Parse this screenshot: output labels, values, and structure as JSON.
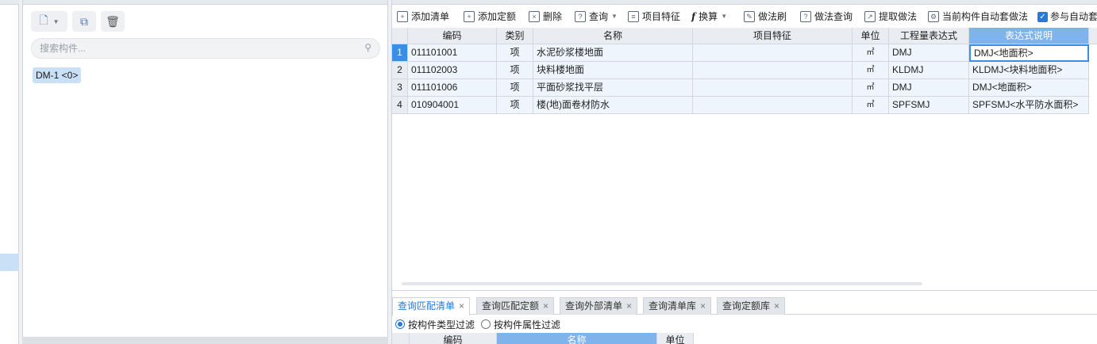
{
  "search": {
    "placeholder": "搜索构件..."
  },
  "component": {
    "item_label": "DM-1 <0>"
  },
  "toolbar": {
    "add_list": "添加清单",
    "add_quota": "添加定额",
    "delete": "删除",
    "query": "查询",
    "item_feature": "项目特征",
    "convert": "换算",
    "method_brush": "做法刷",
    "method_query": "做法查询",
    "extract_method": "提取做法",
    "auto_apply": "当前构件自动套做法",
    "participate_auto": "参与自动套"
  },
  "grid": {
    "columns": [
      "编码",
      "类别",
      "名称",
      "项目特征",
      "单位",
      "工程量表达式",
      "表达式说明"
    ],
    "rows": [
      {
        "index": "1",
        "code": "011101001",
        "type": "项",
        "name": "水泥砂浆楼地面",
        "feature": "",
        "unit": "㎡",
        "expr": "DMJ",
        "desc": "DMJ<地面积>"
      },
      {
        "index": "2",
        "code": "011102003",
        "type": "项",
        "name": "块料楼地面",
        "feature": "",
        "unit": "㎡",
        "expr": "KLDMJ",
        "desc": "KLDMJ<块料地面积>"
      },
      {
        "index": "3",
        "code": "011101006",
        "type": "项",
        "name": "平面砂浆找平层",
        "feature": "",
        "unit": "㎡",
        "expr": "DMJ",
        "desc": "DMJ<地面积>"
      },
      {
        "index": "4",
        "code": "010904001",
        "type": "项",
        "name": "楼(地)面卷材防水",
        "feature": "",
        "unit": "㎡",
        "expr": "SPFSMJ",
        "desc": "SPFSMJ<水平防水面积>"
      }
    ]
  },
  "bottom_tabs": [
    "查询匹配清单",
    "查询匹配定额",
    "查询外部清单",
    "查询清单库",
    "查询定额库"
  ],
  "filters": {
    "by_type": "按构件类型过滤",
    "by_attr": "按构件属性过滤"
  },
  "sub_grid": {
    "columns": [
      "编码",
      "名称",
      "单位"
    ]
  },
  "colors": {
    "accent": "#2b79d6",
    "header_highlight": "#7fb3ec",
    "row_bg": "#eef5fd",
    "selection": "#c9e0f7"
  }
}
